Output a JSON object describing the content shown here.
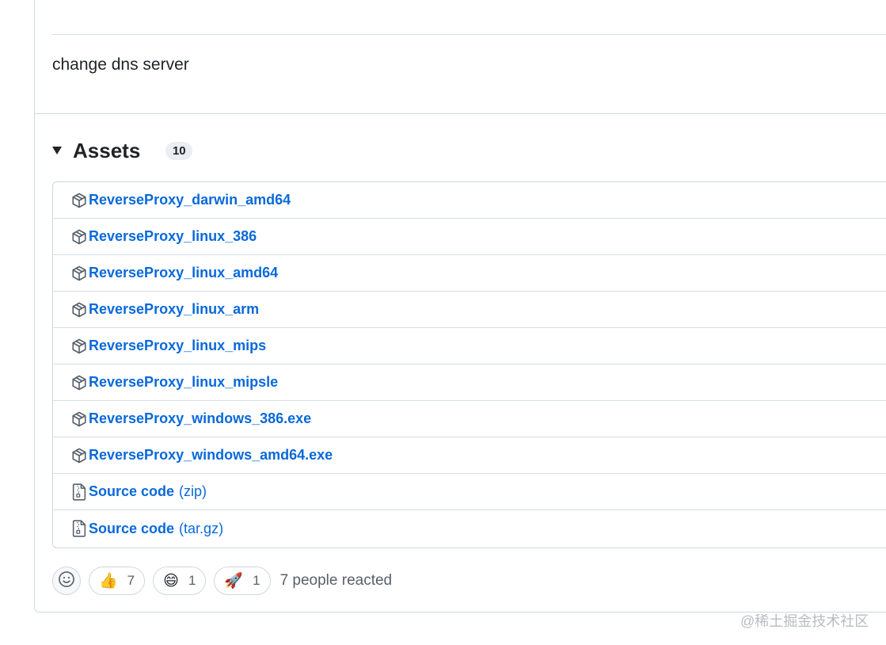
{
  "release": {
    "body_text": "change dns server"
  },
  "assets": {
    "title": "Assets",
    "count": "10",
    "items": [
      {
        "name": "ReverseProxy_darwin_amd64",
        "suffix": "",
        "icon": "package-icon"
      },
      {
        "name": "ReverseProxy_linux_386",
        "suffix": "",
        "icon": "package-icon"
      },
      {
        "name": "ReverseProxy_linux_amd64",
        "suffix": "",
        "icon": "package-icon"
      },
      {
        "name": "ReverseProxy_linux_arm",
        "suffix": "",
        "icon": "package-icon"
      },
      {
        "name": "ReverseProxy_linux_mips",
        "suffix": "",
        "icon": "package-icon"
      },
      {
        "name": "ReverseProxy_linux_mipsle",
        "suffix": "",
        "icon": "package-icon"
      },
      {
        "name": "ReverseProxy_windows_386.exe",
        "suffix": "",
        "icon": "package-icon"
      },
      {
        "name": "ReverseProxy_windows_amd64.exe",
        "suffix": "",
        "icon": "package-icon"
      },
      {
        "name": "Source code",
        "suffix": "(zip)",
        "icon": "file-zip-icon"
      },
      {
        "name": "Source code",
        "suffix": "(tar.gz)",
        "icon": "file-zip-icon"
      }
    ]
  },
  "reactions": {
    "add_icon": "smiley-icon",
    "items": [
      {
        "emoji": "👍",
        "icon": "thumbs-up-icon",
        "count": "7"
      },
      {
        "emoji": "😄",
        "icon": "laugh-icon",
        "count": "1"
      },
      {
        "emoji": "🚀",
        "icon": "rocket-icon",
        "count": "1"
      }
    ],
    "summary": "7 people reacted"
  },
  "watermark": "@稀土掘金技术社区",
  "colors": {
    "link": "#0969da",
    "border": "#d0d7de",
    "text": "#1f2328",
    "muted": "#57606a"
  }
}
